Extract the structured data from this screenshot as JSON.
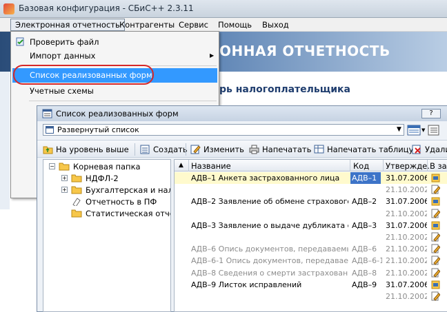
{
  "app": {
    "title": "Базовая конфигурация - СБиС++ 2.3.11"
  },
  "menu": {
    "items": [
      "Электронная отчетность",
      "Контрагенты",
      "Сервис",
      "Помощь",
      "Выход"
    ]
  },
  "background": {
    "banner_text": "ОННАЯ ОТЧЕТНОСТЬ",
    "subtitle": "рь налогоплательщика",
    "hidden_fragments": [
      "О",
      "О",
      "П",
      "П",
      "П",
      "П"
    ]
  },
  "dropdown": {
    "items": [
      {
        "label": "Проверить файл",
        "icon": "check-file-icon"
      },
      {
        "label": "Импорт данных",
        "icon": "",
        "submenu_arrow": "▶"
      },
      {
        "label": "Список реализованных форм",
        "icon": "",
        "highlighted": true
      },
      {
        "label": "Учетные схемы",
        "icon": ""
      }
    ]
  },
  "window": {
    "title": "Список реализованных форм",
    "help_button": "?",
    "view_select": "Развернутый список",
    "toolbar": [
      "На уровень выше",
      "Создать",
      "Изменить",
      "Напечатать",
      "Напечатать таблицу",
      "Удали"
    ]
  },
  "tree": {
    "nodes": [
      {
        "label": "Корневая папка",
        "expander": "−",
        "level": 0
      },
      {
        "label": "НДФЛ-2",
        "expander": "+",
        "level": 1
      },
      {
        "label": "Бухгалтерская и налогс",
        "expander": "+",
        "level": 1
      },
      {
        "label": "Отчетность в ПФ",
        "expander": "",
        "level": 1
      },
      {
        "label": "Статистическая отчетн",
        "expander": "",
        "level": 1
      }
    ]
  },
  "grid": {
    "sort_marker": "▲",
    "columns": [
      "Название",
      "Код",
      "Утвержде.",
      "В за"
    ],
    "rows": [
      {
        "name": "АДВ–1 Анкета застрахованного лица",
        "code": "АДВ–1",
        "date": "31.07.2006",
        "dim": false,
        "selected": true
      },
      {
        "name": "",
        "code": "",
        "date": "21.10.2002",
        "dim": true
      },
      {
        "name": "АДВ–2 Заявление об обмене страхового сви",
        "code": "АДВ–2",
        "date": "31.07.2006",
        "dim": false
      },
      {
        "name": "",
        "code": "",
        "date": "21.10.2002",
        "dim": true
      },
      {
        "name": "АДВ–3 Заявление о выдаче дубликата страх",
        "code": "АДВ–3",
        "date": "31.07.2006",
        "dim": false
      },
      {
        "name": "",
        "code": "",
        "date": "21.10.2002",
        "dim": true
      },
      {
        "name": "АДВ–6 Опись документов, передаваемых ра",
        "code": "АДВ–6",
        "date": "21.10.2002",
        "dim": true
      },
      {
        "name": "АДВ–6-1 Опись документов, передаваемых с",
        "code": "АДВ–6-1",
        "date": "21.10.2002",
        "dim": true
      },
      {
        "name": "АДВ–8 Сведения о смерти застрахованного",
        "code": "АДВ–8",
        "date": "21.10.2002",
        "dim": true
      },
      {
        "name": "АДВ–9 Листок исправлений",
        "code": "АДВ–9",
        "date": "31.07.2006",
        "dim": false
      },
      {
        "name": "",
        "code": "",
        "date": "21.10.2002",
        "dim": true
      }
    ]
  },
  "colors": {
    "highlight": "#3399ff",
    "ring": "#d62828",
    "selected_row": "#fffacd",
    "banner": "#2a4c78"
  }
}
